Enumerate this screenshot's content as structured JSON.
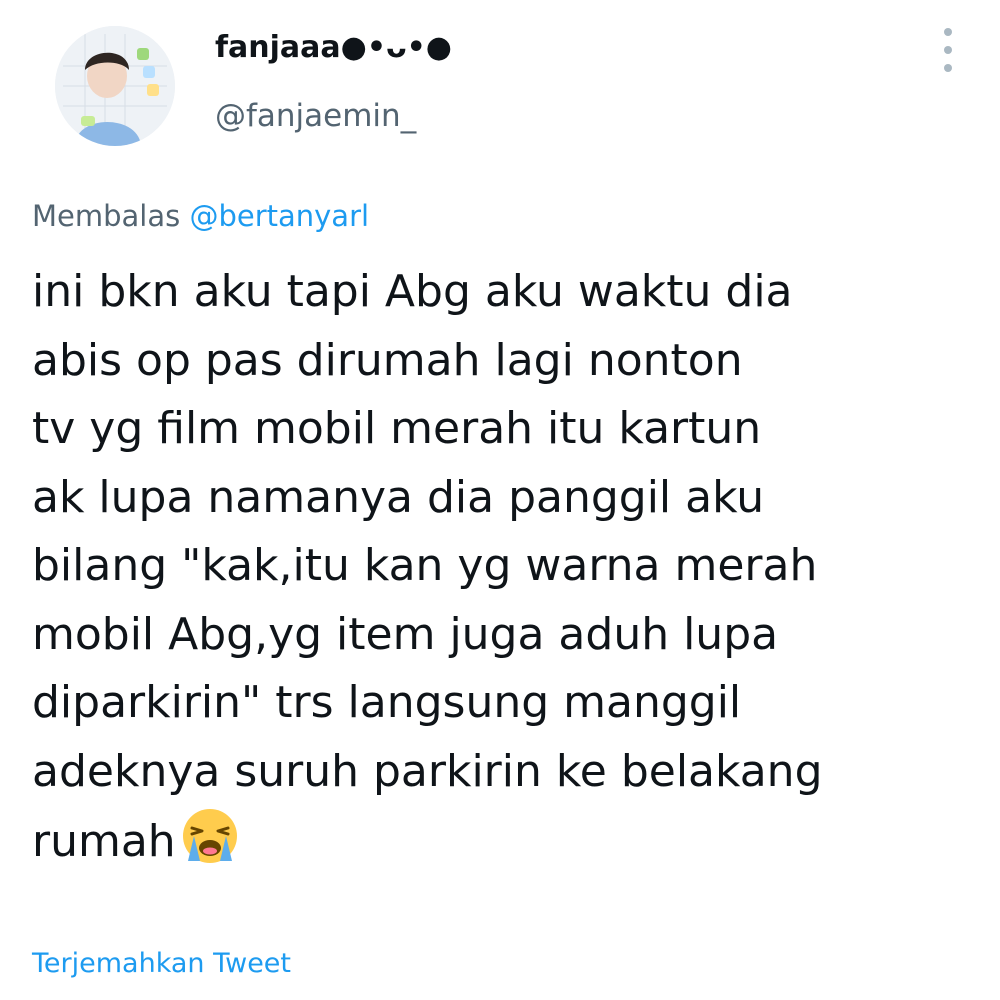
{
  "author": {
    "display_name": "fanjaaa●•ᴗ•●",
    "handle": "@fanjaemin_"
  },
  "reply": {
    "prefix": "Membalas",
    "target": "@bertanyarl"
  },
  "tweet": {
    "lines": [
      "ini bkn aku tapi Abg aku waktu dia",
      "abis op pas dirumah lagi nonton",
      "tv yg film mobil merah itu kartun",
      "ak lupa namanya dia panggil aku",
      "bilang \"kak,itu kan yg warna merah",
      "mobil Abg,yg item juga aduh lupa",
      "diparkirin\" trs langsung manggil",
      "adeknya suruh parkirin ke belakang",
      "rumah"
    ],
    "emoji": "loudly-crying-face-icon"
  },
  "footer": {
    "translate_label": "Terjemahkan Tweet"
  },
  "icons": {
    "more": "more-vertical-icon"
  },
  "colors": {
    "text": "#0f1419",
    "secondary": "#536471",
    "link": "#1d9bf0"
  }
}
